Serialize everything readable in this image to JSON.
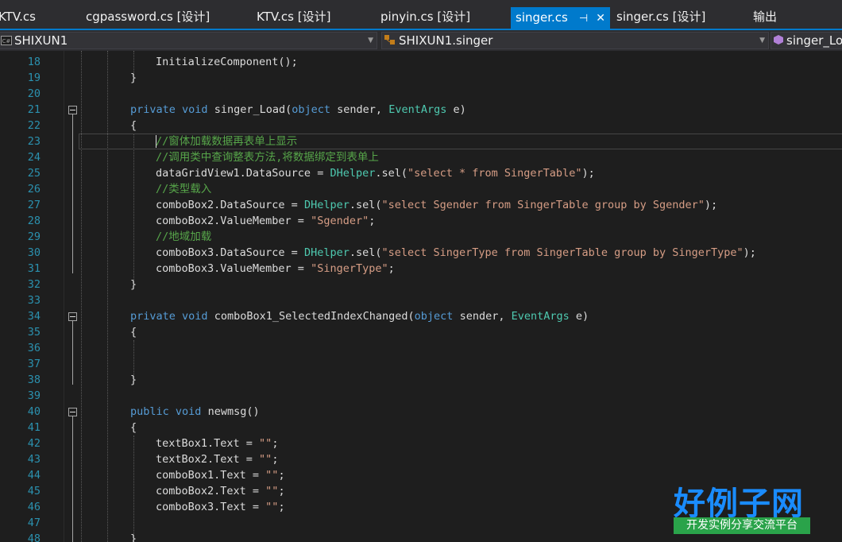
{
  "tabs": [
    {
      "label": "KTV.cs"
    },
    {
      "label": "cgpassword.cs [设计]"
    },
    {
      "label": "KTV.cs [设计]"
    },
    {
      "label": "pinyin.cs [设计]"
    },
    {
      "label": "singer.cs",
      "active": true
    },
    {
      "label": "singer.cs [设计]"
    },
    {
      "label": "输出"
    }
  ],
  "navbar": {
    "project": "SHIXUN1",
    "class_member": "SHIXUN1.singer",
    "method": "singer_Lo"
  },
  "editor": {
    "line_numbers": [
      "18",
      "19",
      "20",
      "21",
      "22",
      "23",
      "24",
      "25",
      "26",
      "27",
      "28",
      "29",
      "30",
      "31",
      "32",
      "33",
      "34",
      "35",
      "36",
      "37",
      "38",
      "39",
      "40",
      "41",
      "42",
      "43",
      "44",
      "45",
      "46",
      "47",
      "48"
    ],
    "lines": {
      "l18": {
        "a": "InitializeComponent();"
      },
      "l19": {
        "a": "}"
      },
      "l21": {
        "kw1": "private",
        "kw2": "void",
        "name": "singer_Load(",
        "t1": "object",
        "p1": " sender, ",
        "t2": "EventArgs",
        "p2": " e)"
      },
      "l22": {
        "a": "{"
      },
      "l23": {
        "c": "//窗体加载数据再表单上显示"
      },
      "l24": {
        "c": "//调用类中查询整表方法,将数据绑定到表单上"
      },
      "l25": {
        "a": "dataGridView1.DataSource = ",
        "t": "DHelper",
        "b": ".sel(",
        "s": "\"select * from SingerTable\"",
        "e": ");"
      },
      "l26": {
        "c": "//类型载入"
      },
      "l27": {
        "a": "comboBox2.DataSource = ",
        "t": "DHelper",
        "b": ".sel(",
        "s": "\"select Sgender from SingerTable group by Sgender\"",
        "e": ");"
      },
      "l28": {
        "a": "comboBox2.ValueMember = ",
        "s": "\"Sgender\"",
        "e": ";"
      },
      "l29": {
        "c": "//地域加载"
      },
      "l30": {
        "a": "comboBox3.DataSource = ",
        "t": "DHelper",
        "b": ".sel(",
        "s": "\"select SingerType from SingerTable group by SingerType\"",
        "e": ");"
      },
      "l31": {
        "a": "comboBox3.ValueMember = ",
        "s": "\"SingerType\"",
        "e": ";"
      },
      "l32": {
        "a": "}"
      },
      "l34": {
        "kw1": "private",
        "kw2": "void",
        "name": "comboBox1_SelectedIndexChanged(",
        "t1": "object",
        "p1": " sender, ",
        "t2": "EventArgs",
        "p2": " e)"
      },
      "l35": {
        "a": "{"
      },
      "l38": {
        "a": "}"
      },
      "l40": {
        "kw1": "public",
        "kw2": "void",
        "name": "newmsg()"
      },
      "l41": {
        "a": "{"
      },
      "l42": {
        "a": "textBox1.Text = ",
        "s": "\"\"",
        "e": ";"
      },
      "l43": {
        "a": "textBox2.Text = ",
        "s": "\"\"",
        "e": ";"
      },
      "l44": {
        "a": "comboBox1.Text = ",
        "s": "\"\"",
        "e": ";"
      },
      "l45": {
        "a": "comboBox2.Text = ",
        "s": "\"\"",
        "e": ";"
      },
      "l46": {
        "a": "comboBox3.Text = ",
        "s": "\"\"",
        "e": ";"
      },
      "l48": {
        "a": "}"
      }
    }
  },
  "watermark": {
    "title": "好例子网",
    "subtitle": "开发实例分享交流平台"
  },
  "colors": {
    "accent": "#007acc",
    "keyword": "#569cd6",
    "type": "#4ec9b0",
    "string": "#d69d85",
    "comment": "#57a64a",
    "line_number": "#2b91af"
  },
  "icons": [
    "pin-icon",
    "close-icon",
    "csharp-project-icon",
    "class-icon",
    "method-icon",
    "collapse-icon",
    "dropdown-arrow-icon"
  ]
}
